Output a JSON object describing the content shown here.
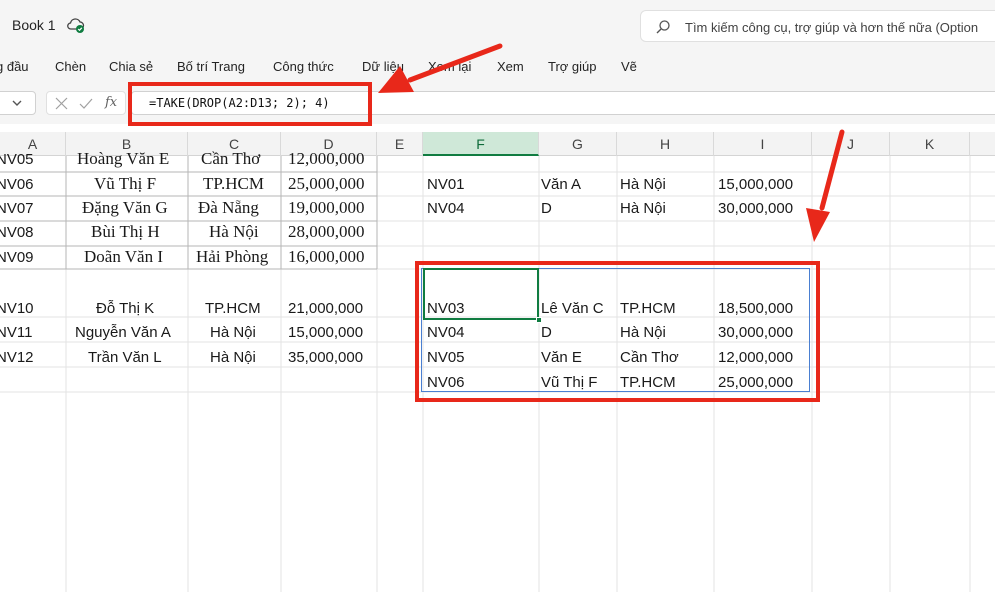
{
  "app": {
    "title": "Book 1",
    "save_status_icon": "cloud-saved-icon",
    "search_placeholder": "Tìm kiếm công cụ, trợ giúp và hơn thế nữa (Option"
  },
  "ribbon": {
    "tabs": [
      "g đầu",
      "Chèn",
      "Chia sẻ",
      "Bố trí Trang",
      "Công thức",
      "Dữ liệu",
      "Xem lại",
      "Xem",
      "Trợ giúp",
      "Vẽ"
    ]
  },
  "formula_bar": {
    "fx_label": "fx",
    "formula": "=TAKE(DROP(A2:D13; 2); 4)"
  },
  "sheet": {
    "columns": [
      "A",
      "B",
      "C",
      "D",
      "E",
      "F",
      "G",
      "H",
      "I",
      "J",
      "K"
    ],
    "selected_column": "F",
    "left_table": [
      {
        "id": "NV05",
        "name": "Hoàng Văn E",
        "city": "Cần Thơ",
        "salary": "12,000,000"
      },
      {
        "id": "NV06",
        "name": "Vũ Thị F",
        "city": "TP.HCM",
        "salary": "25,000,000"
      },
      {
        "id": "NV07",
        "name": "Đặng Văn G",
        "city": "Đà Nẵng",
        "salary": "19,000,000"
      },
      {
        "id": "NV08",
        "name": "Bùi Thị H",
        "city": "Hà Nội",
        "salary": "28,000,000"
      },
      {
        "id": "NV09",
        "name": "Doãn Văn I",
        "city": "Hải Phòng",
        "salary": "16,000,000"
      },
      {
        "id": "NV10",
        "name": "Đỗ Thị K",
        "city": "TP.HCM",
        "salary": "21,000,000"
      },
      {
        "id": "NV11",
        "name": "Nguyễn Văn A",
        "city": "Hà Nội",
        "salary": "15,000,000"
      },
      {
        "id": "NV12",
        "name": "Trần Văn L",
        "city": "Hà Nội",
        "salary": "35,000,000"
      }
    ],
    "right_top": [
      {
        "id": "NV01",
        "name": "Văn A",
        "city": "Hà Nội",
        "salary": "15,000,000"
      },
      {
        "id": "NV04",
        "name": "D",
        "city": "Hà Nội",
        "salary": "30,000,000"
      }
    ],
    "result": [
      {
        "id": "NV03",
        "name": "Lê Văn C",
        "city": "TP.HCM",
        "salary": "18,500,000"
      },
      {
        "id": "NV04",
        "name": "D",
        "city": "Hà Nội",
        "salary": "30,000,000"
      },
      {
        "id": "NV05",
        "name": "Văn E",
        "city": "Cần Thơ",
        "salary": "12,000,000"
      },
      {
        "id": "NV06",
        "name": "Vũ Thị F",
        "city": "TP.HCM",
        "salary": "25,000,000"
      }
    ]
  },
  "colors": {
    "excel_green": "#107c41",
    "annotation_red": "#e8281a",
    "spill_blue": "#4a7fd1"
  }
}
